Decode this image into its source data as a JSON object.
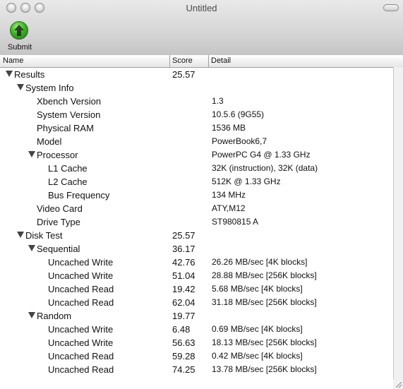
{
  "window": {
    "title": "Untitled"
  },
  "toolbar": {
    "submit_label": "Submit",
    "submit_icon": "submit-arrow-up-icon",
    "accent": "#3db327"
  },
  "table": {
    "columns": [
      "Name",
      "Score",
      "Detail"
    ],
    "rows": [
      {
        "name": "Results",
        "score": "25.57",
        "detail": "",
        "level": 0,
        "expandable": true
      },
      {
        "name": "System Info",
        "score": "",
        "detail": "",
        "level": 1,
        "expandable": true
      },
      {
        "name": "Xbench Version",
        "score": "",
        "detail": "1.3",
        "level": 2,
        "expandable": false
      },
      {
        "name": "System Version",
        "score": "",
        "detail": "10.5.6 (9G55)",
        "level": 2,
        "expandable": false
      },
      {
        "name": "Physical RAM",
        "score": "",
        "detail": "1536 MB",
        "level": 2,
        "expandable": false
      },
      {
        "name": "Model",
        "score": "",
        "detail": "PowerBook6,7",
        "level": 2,
        "expandable": false
      },
      {
        "name": "Processor",
        "score": "",
        "detail": "PowerPC G4 @ 1.33 GHz",
        "level": 2,
        "expandable": true
      },
      {
        "name": "L1 Cache",
        "score": "",
        "detail": "32K (instruction), 32K (data)",
        "level": 3,
        "expandable": false
      },
      {
        "name": "L2 Cache",
        "score": "",
        "detail": "512K @ 1.33 GHz",
        "level": 3,
        "expandable": false
      },
      {
        "name": "Bus Frequency",
        "score": "",
        "detail": "134 MHz",
        "level": 3,
        "expandable": false
      },
      {
        "name": "Video Card",
        "score": "",
        "detail": "ATY,M12",
        "level": 2,
        "expandable": false
      },
      {
        "name": "Drive Type",
        "score": "",
        "detail": "ST980815 A",
        "level": 2,
        "expandable": false
      },
      {
        "name": "Disk Test",
        "score": "25.57",
        "detail": "",
        "level": 1,
        "expandable": true
      },
      {
        "name": "Sequential",
        "score": "36.17",
        "detail": "",
        "level": 2,
        "expandable": true
      },
      {
        "name": "Uncached Write",
        "score": "42.76",
        "detail": "26.26 MB/sec [4K blocks]",
        "level": 3,
        "expandable": false
      },
      {
        "name": "Uncached Write",
        "score": "51.04",
        "detail": "28.88 MB/sec [256K blocks]",
        "level": 3,
        "expandable": false
      },
      {
        "name": "Uncached Read",
        "score": "19.42",
        "detail": "5.68 MB/sec [4K blocks]",
        "level": 3,
        "expandable": false
      },
      {
        "name": "Uncached Read",
        "score": "62.04",
        "detail": "31.18 MB/sec [256K blocks]",
        "level": 3,
        "expandable": false
      },
      {
        "name": "Random",
        "score": "19.77",
        "detail": "",
        "level": 2,
        "expandable": true
      },
      {
        "name": "Uncached Write",
        "score": "6.48",
        "detail": "0.69 MB/sec [4K blocks]",
        "level": 3,
        "expandable": false
      },
      {
        "name": "Uncached Write",
        "score": "56.63",
        "detail": "18.13 MB/sec [256K blocks]",
        "level": 3,
        "expandable": false
      },
      {
        "name": "Uncached Read",
        "score": "59.28",
        "detail": "0.42 MB/sec [4K blocks]",
        "level": 3,
        "expandable": false
      },
      {
        "name": "Uncached Read",
        "score": "74.25",
        "detail": "13.78 MB/sec [256K blocks]",
        "level": 3,
        "expandable": false
      }
    ]
  }
}
